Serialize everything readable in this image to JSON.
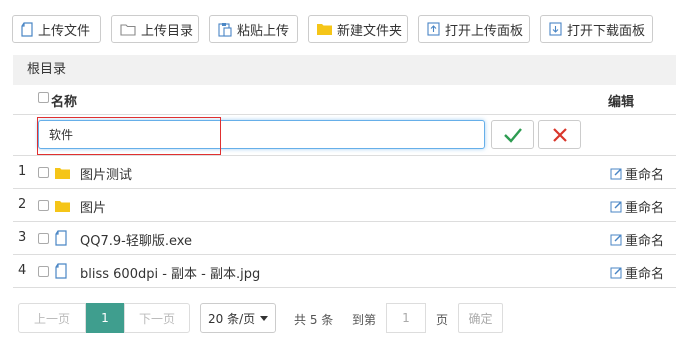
{
  "toolbar": {
    "upload_file": "上传文件",
    "upload_dir": "上传目录",
    "paste_upload": "粘贴上传",
    "new_folder": "新建文件夹",
    "open_upload_panel": "打开上传面板",
    "open_download_panel": "打开下载面板"
  },
  "breadcrumb": {
    "root": "根目录"
  },
  "table": {
    "col_name": "名称",
    "col_edit": "编辑",
    "edit_value": "软件",
    "rows": [
      {
        "num": "1",
        "name": "图片测试",
        "type": "folder",
        "action": "重命名"
      },
      {
        "num": "2",
        "name": "图片",
        "type": "folder",
        "action": "重命名"
      },
      {
        "num": "3",
        "name": "QQ7.9-轻聊版.exe",
        "type": "file",
        "action": "重命名"
      },
      {
        "num": "4",
        "name": "bliss 600dpi - 副本 - 副本.jpg",
        "type": "file",
        "action": "重命名"
      }
    ]
  },
  "pagination": {
    "prev": "上一页",
    "current": "1",
    "next": "下一页",
    "page_size": "20 条/页",
    "total": "共 5 条",
    "goto_label": "到第",
    "goto_value": "1",
    "page_unit": "页",
    "confirm": "确定"
  },
  "colors": {
    "accent": "#3f9e8e",
    "folder": "#f5c518",
    "file_icon": "#4a86c5",
    "ok": "#2e9c52",
    "cancel": "#d9362b"
  }
}
